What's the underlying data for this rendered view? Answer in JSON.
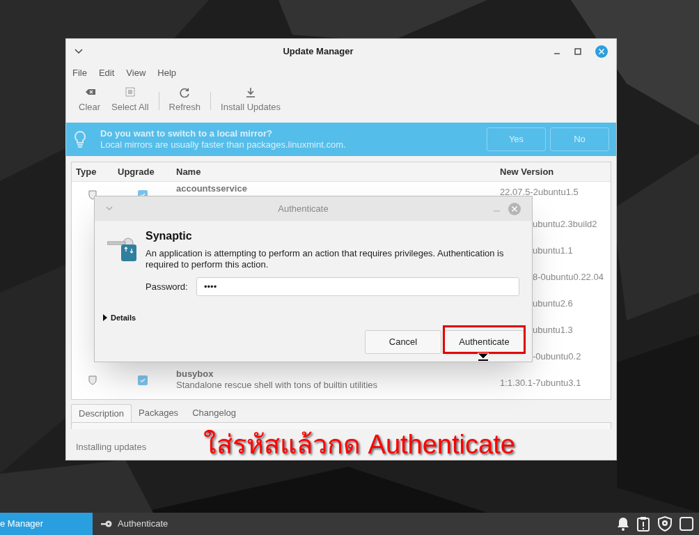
{
  "window": {
    "title": "Update Manager"
  },
  "menu": [
    "File",
    "Edit",
    "View",
    "Help"
  ],
  "toolbar": [
    {
      "label": "Clear",
      "kind": "clear"
    },
    {
      "label": "Select All",
      "kind": "select"
    },
    {
      "label": "Refresh",
      "kind": "refresh"
    },
    {
      "label": "Install Updates",
      "kind": "install"
    }
  ],
  "infobar": {
    "title": "Do you want to switch to a local mirror?",
    "message": "Local mirrors are usually faster than packages.linuxmint.com.",
    "buttons": [
      "Yes",
      "No"
    ]
  },
  "table": {
    "columns": [
      "Type",
      "Upgrade",
      "Name",
      "New Version"
    ],
    "rows": [
      {
        "kind": "full",
        "name": "accountsservice",
        "new_version": "22.07.5-2ubuntu1.5",
        "checked": true
      },
      {
        "kind": "partial",
        "new_version": "ubuntu2.3build2"
      },
      {
        "kind": "partial",
        "new_version": "ubuntu1.1"
      },
      {
        "kind": "partial",
        "new_version": "8-0ubuntu0.22.04"
      },
      {
        "kind": "partial",
        "new_version": "ubuntu2.6"
      },
      {
        "kind": "partial",
        "new_version": "ubuntu1.3"
      },
      {
        "kind": "partial",
        "new_version": "-0ubuntu0.2"
      },
      {
        "kind": "full",
        "name": "busybox",
        "description": "Standalone rescue shell with tons of builtin utilities",
        "new_version": "1:1.30.1-7ubuntu3.1",
        "checked": true
      }
    ]
  },
  "tabs": [
    {
      "label": "Description",
      "selected": true
    },
    {
      "label": "Packages",
      "selected": false
    },
    {
      "label": "Changelog",
      "selected": false
    }
  ],
  "status_bar": "Installing updates",
  "dialog": {
    "title": "Authenticate",
    "heading": "Synaptic",
    "message": "An application is attempting to perform an action that requires privileges. Authentication is required to perform this action.",
    "password_label": "Password:",
    "password_value": "••••",
    "details_label": "Details",
    "buttons": [
      {
        "label": "Cancel",
        "highlighted": false
      },
      {
        "label": "Authenticate",
        "highlighted": true
      }
    ]
  },
  "annotation": "ใส่รหัสแล้วกด Authenticate",
  "taskbar": {
    "items": [
      {
        "label": "e Manager",
        "selected": true,
        "kind": "plain"
      },
      {
        "label": "Authenticate",
        "selected": false,
        "kind": "key"
      }
    ]
  }
}
